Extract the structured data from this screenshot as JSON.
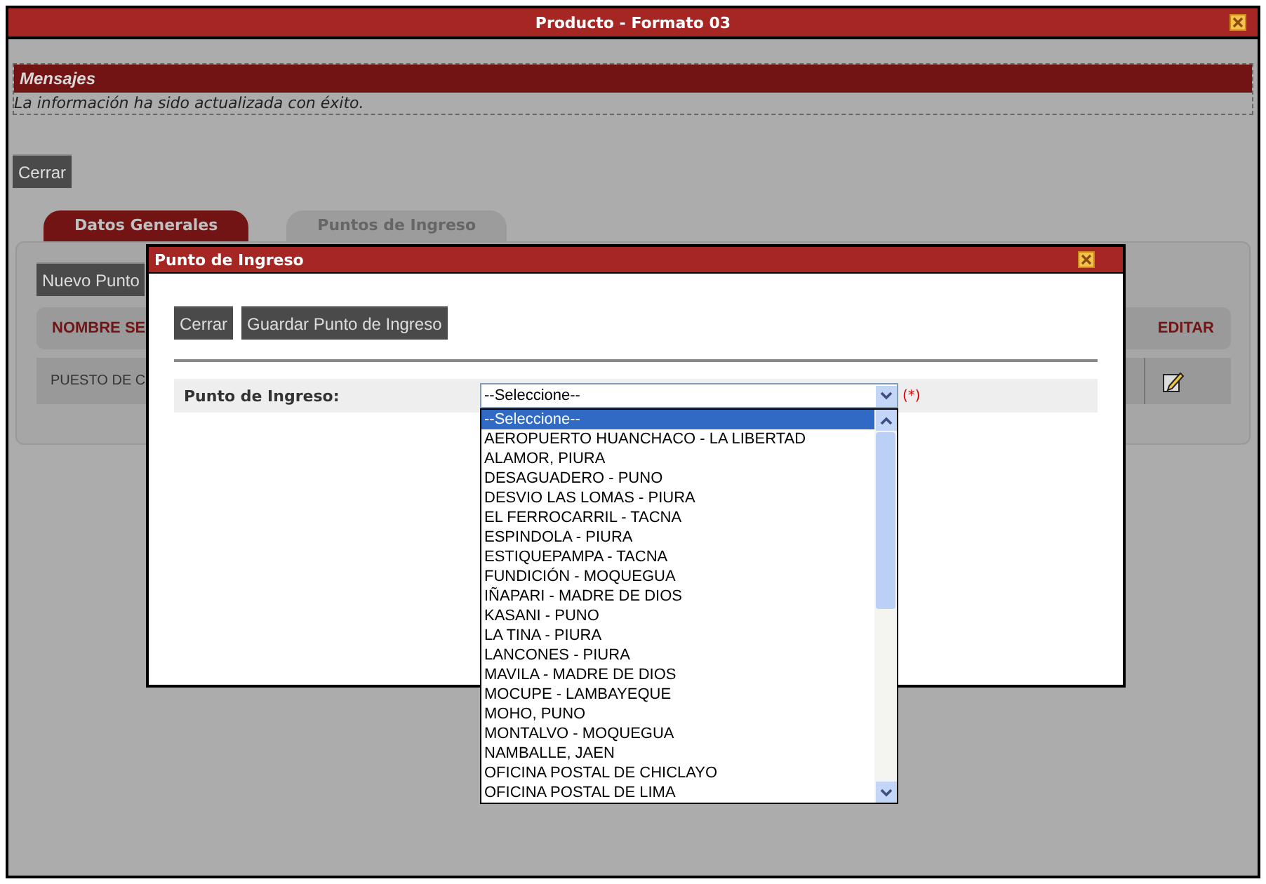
{
  "window": {
    "title": "Producto - Formato 03"
  },
  "messages": {
    "title": "Mensajes",
    "text": "La información ha sido actualizada con éxito."
  },
  "close_button": "Cerrar",
  "tabs": [
    {
      "label": "Datos Generales",
      "selected": true
    },
    {
      "label": "Puntos de Ingreso",
      "selected": false
    }
  ],
  "new_button": "Nuevo Punto",
  "table": {
    "columns": [
      "NOMBRE SE",
      "EDITAR"
    ],
    "rows": [
      {
        "cells": [
          "PUESTO DE C"
        ]
      }
    ]
  },
  "dialog": {
    "title": "Punto de Ingreso",
    "buttons": [
      "Cerrar",
      "Guardar Punto de Ingreso"
    ],
    "field": {
      "label": "Punto de Ingreso:",
      "value": "--Seleccione--",
      "required": "(*)",
      "expanded": true,
      "options": [
        {
          "label": "--Seleccione--",
          "selected": true
        },
        {
          "label": "AEROPUERTO HUANCHACO - LA LIBERTAD",
          "selected": false
        },
        {
          "label": "ALAMOR, PIURA",
          "selected": false
        },
        {
          "label": "DESAGUADERO - PUNO",
          "selected": false
        },
        {
          "label": "DESVIO LAS LOMAS - PIURA",
          "selected": false
        },
        {
          "label": "EL FERROCARRIL - TACNA",
          "selected": false
        },
        {
          "label": "ESPINDOLA - PIURA",
          "selected": false
        },
        {
          "label": "ESTIQUEPAMPA - TACNA",
          "selected": false
        },
        {
          "label": "FUNDICIÓN - MOQUEGUA",
          "selected": false
        },
        {
          "label": "IÑAPARI - MADRE DE DIOS",
          "selected": false
        },
        {
          "label": "KASANI - PUNO",
          "selected": false
        },
        {
          "label": "LA TINA - PIURA",
          "selected": false
        },
        {
          "label": "LANCONES - PIURA",
          "selected": false
        },
        {
          "label": "MAVILA - MADRE DE DIOS",
          "selected": false
        },
        {
          "label": "MOCUPE - LAMBAYEQUE",
          "selected": false
        },
        {
          "label": "MOHO, PUNO",
          "selected": false
        },
        {
          "label": "MONTALVO - MOQUEGUA",
          "selected": false
        },
        {
          "label": "NAMBALLE, JAEN",
          "selected": false
        },
        {
          "label": "OFICINA POSTAL DE CHICLAYO",
          "selected": false
        },
        {
          "label": "OFICINA POSTAL DE LIMA",
          "selected": false
        }
      ]
    }
  }
}
